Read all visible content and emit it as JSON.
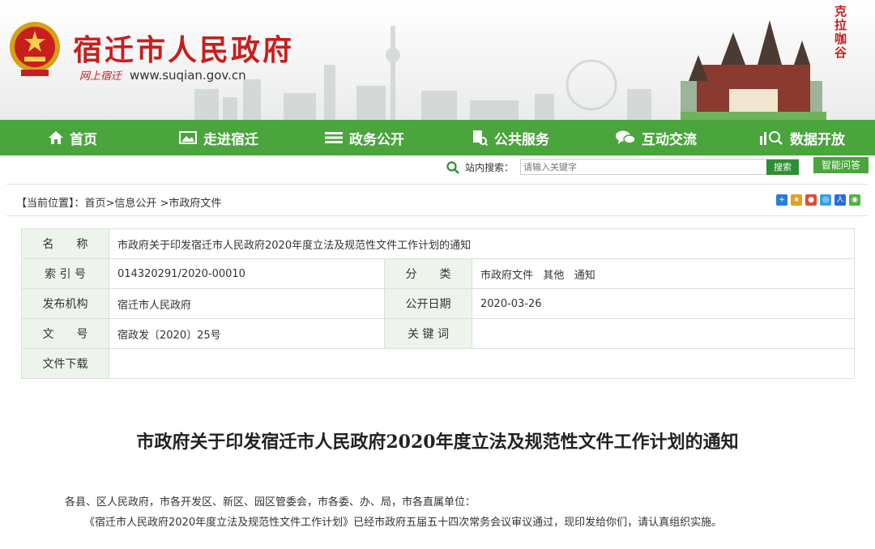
{
  "header": {
    "title": "宿迁市人民政府",
    "calligraphy": "网上宿迁",
    "url": "www.suqian.gov.cn",
    "right_calligraphy": "克拉咖谷"
  },
  "nav": {
    "items": [
      {
        "label": "首页",
        "icon": "home-icon"
      },
      {
        "label": "走进宿迁",
        "icon": "picture-icon"
      },
      {
        "label": "政务公开",
        "icon": "list-icon"
      },
      {
        "label": "公共服务",
        "icon": "document-search-icon"
      },
      {
        "label": "互动交流",
        "icon": "chat-icon"
      },
      {
        "label": "数据开放",
        "icon": "data-chart-icon"
      }
    ]
  },
  "search": {
    "label": "站内搜索：",
    "placeholder": "请输入关键字",
    "button": "搜索",
    "ai_button": "智能问答"
  },
  "breadcrumb": {
    "prefix": "【当前位置】",
    "path": "：首页>信息公开 >市政府文件"
  },
  "meta": {
    "name_label": "名　　称",
    "name_value": "市政府关于印发宿迁市人民政府2020年度立法及规范性文件工作计划的通知",
    "index_label": "索 引 号",
    "index_value": "014320291/2020-00010",
    "category_label": "分　　类",
    "category_value": "市政府文件   其他   通知",
    "publisher_label": "发布机构",
    "publisher_value": "宿迁市人民政府",
    "date_label": "公开日期",
    "date_value": "2020-03-26",
    "docno_label": "文　　号",
    "docno_value": "宿政发〔2020〕25号",
    "keyword_label": "关 键 词",
    "keyword_value": "",
    "download_label": "文件下载",
    "download_value": ""
  },
  "article": {
    "title": "市政府关于印发宿迁市人民政府2020年度立法及规范性文件工作计划的通知",
    "salutation": "各县、区人民政府，市各开发区、新区、园区管委会，市各委、办、局，市各直属单位：",
    "body": "《宿迁市人民政府2020年度立法及规范性文件工作计划》已经市政府五届五十四次常务会议审议通过，现印发给你们，请认真组织实施。"
  },
  "colors": {
    "nav_green": "#49a53c",
    "title_red": "#c81e1e",
    "label_bg": "#edf4eb"
  }
}
